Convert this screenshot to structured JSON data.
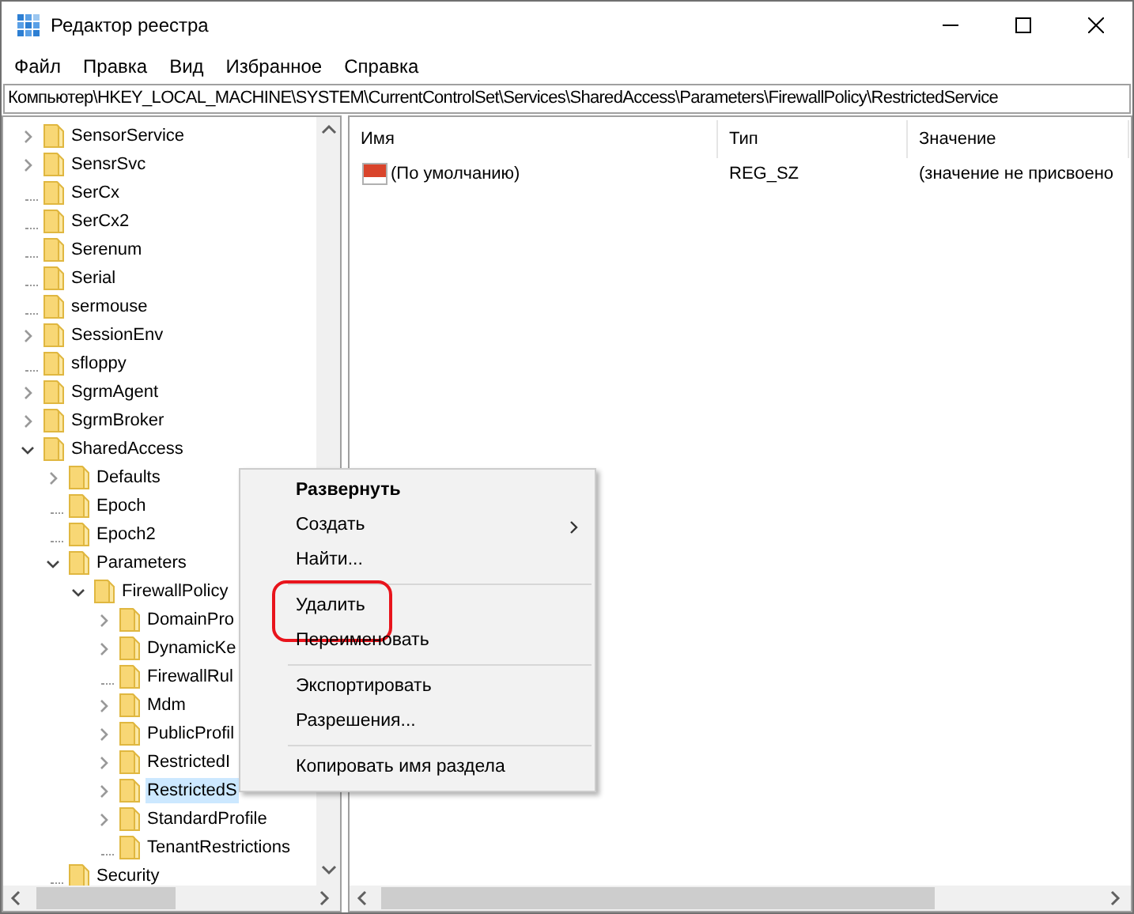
{
  "window": {
    "title": "Редактор реестра"
  },
  "menu": [
    "Файл",
    "Правка",
    "Вид",
    "Избранное",
    "Справка"
  ],
  "address": "Компьютер\\HKEY_LOCAL_MACHINE\\SYSTEM\\CurrentControlSet\\Services\\SharedAccess\\Parameters\\FirewallPolicy\\RestrictedService",
  "tree": [
    {
      "label": "SensorService",
      "kind": "branch",
      "expanded": false,
      "selected": false
    },
    {
      "label": "SensrSvc",
      "kind": "branch",
      "expanded": false,
      "selected": false
    },
    {
      "label": "SerCx",
      "kind": "leaf",
      "selected": false
    },
    {
      "label": "SerCx2",
      "kind": "leaf",
      "selected": false
    },
    {
      "label": "Serenum",
      "kind": "leaf",
      "selected": false
    },
    {
      "label": "Serial",
      "kind": "leaf",
      "selected": false
    },
    {
      "label": "sermouse",
      "kind": "leaf",
      "selected": false
    },
    {
      "label": "SessionEnv",
      "kind": "branch",
      "expanded": false,
      "selected": false
    },
    {
      "label": "sfloppy",
      "kind": "leaf",
      "selected": false
    },
    {
      "label": "SgrmAgent",
      "kind": "branch",
      "expanded": false,
      "selected": false
    },
    {
      "label": "SgrmBroker",
      "kind": "branch",
      "expanded": false,
      "selected": false
    },
    {
      "label": "SharedAccess",
      "kind": "branch",
      "expanded": true,
      "selected": false,
      "children": [
        {
          "label": "Defaults",
          "kind": "branch",
          "expanded": false,
          "selected": false
        },
        {
          "label": "Epoch",
          "kind": "leaf",
          "selected": false
        },
        {
          "label": "Epoch2",
          "kind": "leaf",
          "selected": false
        },
        {
          "label": "Parameters",
          "kind": "branch",
          "expanded": true,
          "selected": false,
          "children": [
            {
              "label": "FirewallPolicy",
              "kind": "branch",
              "expanded": true,
              "selected": false,
              "children": [
                {
                  "label": "DomainPro",
                  "kind": "branch",
                  "expanded": false,
                  "selected": false
                },
                {
                  "label": "DynamicKe",
                  "kind": "branch",
                  "expanded": false,
                  "selected": false
                },
                {
                  "label": "FirewallRul",
                  "kind": "leaf",
                  "selected": false
                },
                {
                  "label": "Mdm",
                  "kind": "branch",
                  "expanded": false,
                  "selected": false
                },
                {
                  "label": "PublicProfil",
                  "kind": "branch",
                  "expanded": false,
                  "selected": false
                },
                {
                  "label": "RestrictedI",
                  "kind": "branch",
                  "expanded": false,
                  "selected": false
                },
                {
                  "label": "RestrictedS",
                  "kind": "branch",
                  "expanded": false,
                  "selected": true
                },
                {
                  "label": "StandardProfile",
                  "kind": "branch",
                  "expanded": false,
                  "selected": false
                },
                {
                  "label": "TenantRestrictions",
                  "kind": "leaf",
                  "selected": false
                }
              ]
            }
          ]
        },
        {
          "label": "Security",
          "kind": "leaf",
          "selected": false
        }
      ]
    }
  ],
  "list": {
    "columns": [
      "Имя",
      "Тип",
      "Значение"
    ],
    "rows": [
      {
        "name": "(По умолчанию)",
        "type": "REG_SZ",
        "value": "(значение не присвоено"
      }
    ]
  },
  "context_menu": {
    "items": [
      {
        "kind": "item",
        "label": "Развернуть",
        "bold": true,
        "submenu": false,
        "highlighted": false
      },
      {
        "kind": "item",
        "label": "Создать",
        "bold": false,
        "submenu": true,
        "highlighted": false
      },
      {
        "kind": "item",
        "label": "Найти...",
        "bold": false,
        "submenu": false,
        "highlighted": false
      },
      {
        "kind": "separator"
      },
      {
        "kind": "item",
        "label": "Удалить",
        "bold": false,
        "submenu": false,
        "highlighted": true
      },
      {
        "kind": "item",
        "label": "Переименовать",
        "bold": false,
        "submenu": false,
        "highlighted": false
      },
      {
        "kind": "separator"
      },
      {
        "kind": "item",
        "label": "Экспортировать",
        "bold": false,
        "submenu": false,
        "highlighted": false
      },
      {
        "kind": "item",
        "label": "Разрешения...",
        "bold": false,
        "submenu": false,
        "highlighted": false
      },
      {
        "kind": "separator"
      },
      {
        "kind": "item",
        "label": "Копировать имя раздела",
        "bold": false,
        "submenu": false,
        "highlighted": false
      }
    ]
  }
}
